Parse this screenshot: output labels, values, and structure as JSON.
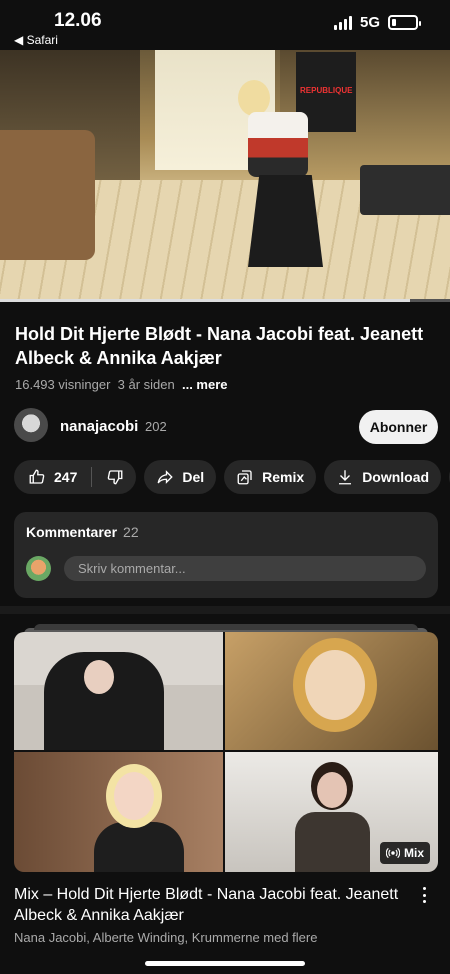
{
  "status": {
    "time": "12.06",
    "back_app": "◀ Safari",
    "network": "5G",
    "battery_level": 0.2
  },
  "player": {
    "progress": 0.91
  },
  "video": {
    "title": "Hold Dit Hjerte Blødt - Nana Jacobi feat. Jeanett Albeck & Annika Aakjær",
    "views": "16.493 visninger",
    "age": "3 år siden",
    "more": "... mere"
  },
  "channel": {
    "name": "nanajacobi",
    "subscribers": "202",
    "subscribe_label": "Abonner"
  },
  "actions": {
    "likes": "247",
    "share": "Del",
    "remix": "Remix",
    "download": "Download"
  },
  "comments": {
    "label": "Kommentarer",
    "count": "22",
    "placeholder": "Skriv kommentar..."
  },
  "mix": {
    "badge": "Mix",
    "title": "Mix – Hold Dit Hjerte Blødt - Nana Jacobi feat. Jeanett Albeck & Annika Aakjær",
    "subtitle": "Nana Jacobi, Alberte Winding, Krummerne med flere"
  }
}
